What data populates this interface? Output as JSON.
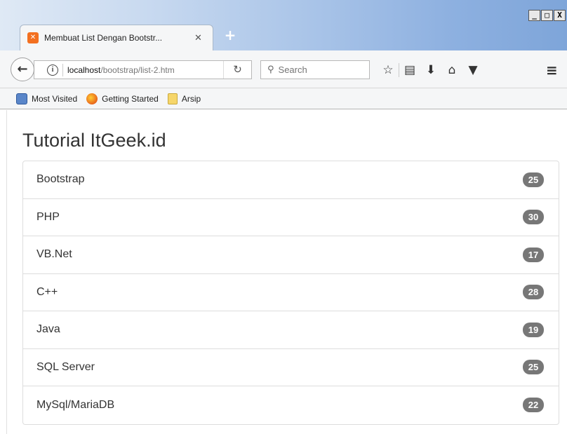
{
  "browser": {
    "window_controls": [
      "_",
      "□",
      "X"
    ],
    "tab": {
      "favicon": "xampp-icon",
      "title": "Membuat List Dengan Bootstr...",
      "close": "✕"
    },
    "new_tab": "+",
    "url": {
      "host": "localhost",
      "path": "/bootstrap/list-2.htm"
    },
    "search": {
      "placeholder": "Search"
    },
    "toolbar_icons": [
      "star-icon",
      "reading-list-icon",
      "download-icon",
      "home-icon",
      "pocket-icon",
      "menu-icon"
    ],
    "bookmarks": [
      {
        "label": "Most Visited",
        "icon": "most-visited-icon"
      },
      {
        "label": "Getting Started",
        "icon": "firefox-icon"
      },
      {
        "label": "Arsip",
        "icon": "folder-icon"
      }
    ]
  },
  "page": {
    "title": "Tutorial ItGeek.id",
    "items": [
      {
        "label": "Bootstrap",
        "badge": "25"
      },
      {
        "label": "PHP",
        "badge": "30"
      },
      {
        "label": "VB.Net",
        "badge": "17"
      },
      {
        "label": "C++",
        "badge": "28"
      },
      {
        "label": "Java",
        "badge": "19"
      },
      {
        "label": "SQL Server",
        "badge": "25"
      },
      {
        "label": "MySql/MariaDB",
        "badge": "22"
      }
    ]
  },
  "colors": {
    "badge": "#777777",
    "accent_tab": "#f37020"
  }
}
